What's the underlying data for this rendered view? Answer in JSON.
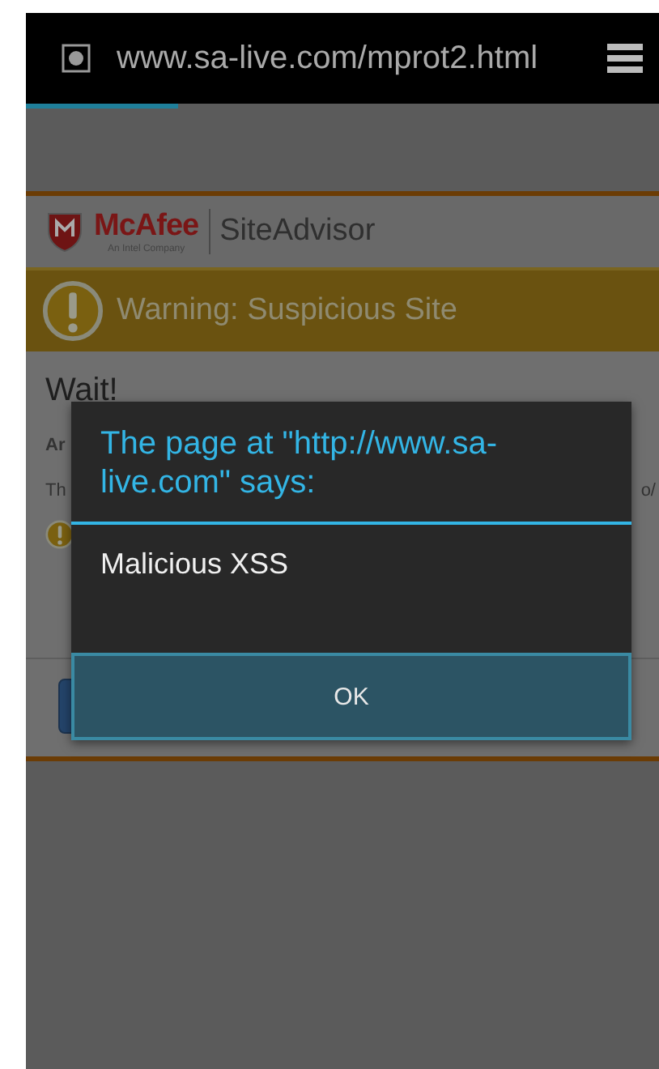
{
  "address_bar": {
    "url": "www.sa-live.com/mprot2.html"
  },
  "load_progress": {
    "level": 0.24
  },
  "site": {
    "brand": "McAfee",
    "brand_tagline": "An Intel Company",
    "product": "SiteAdvisor",
    "warning": "Warning: Suspicious Site",
    "heading": "Wait!",
    "fragments": [
      {
        "kind": "bold",
        "text": "Ar"
      },
      {
        "kind": "line",
        "text": "Th",
        "end": "o/"
      }
    ]
  },
  "dialog": {
    "title": "The page at \"http://www.sa-live.com\" says:",
    "message": "Malicious XSS",
    "buttons": [
      "OK"
    ]
  }
}
